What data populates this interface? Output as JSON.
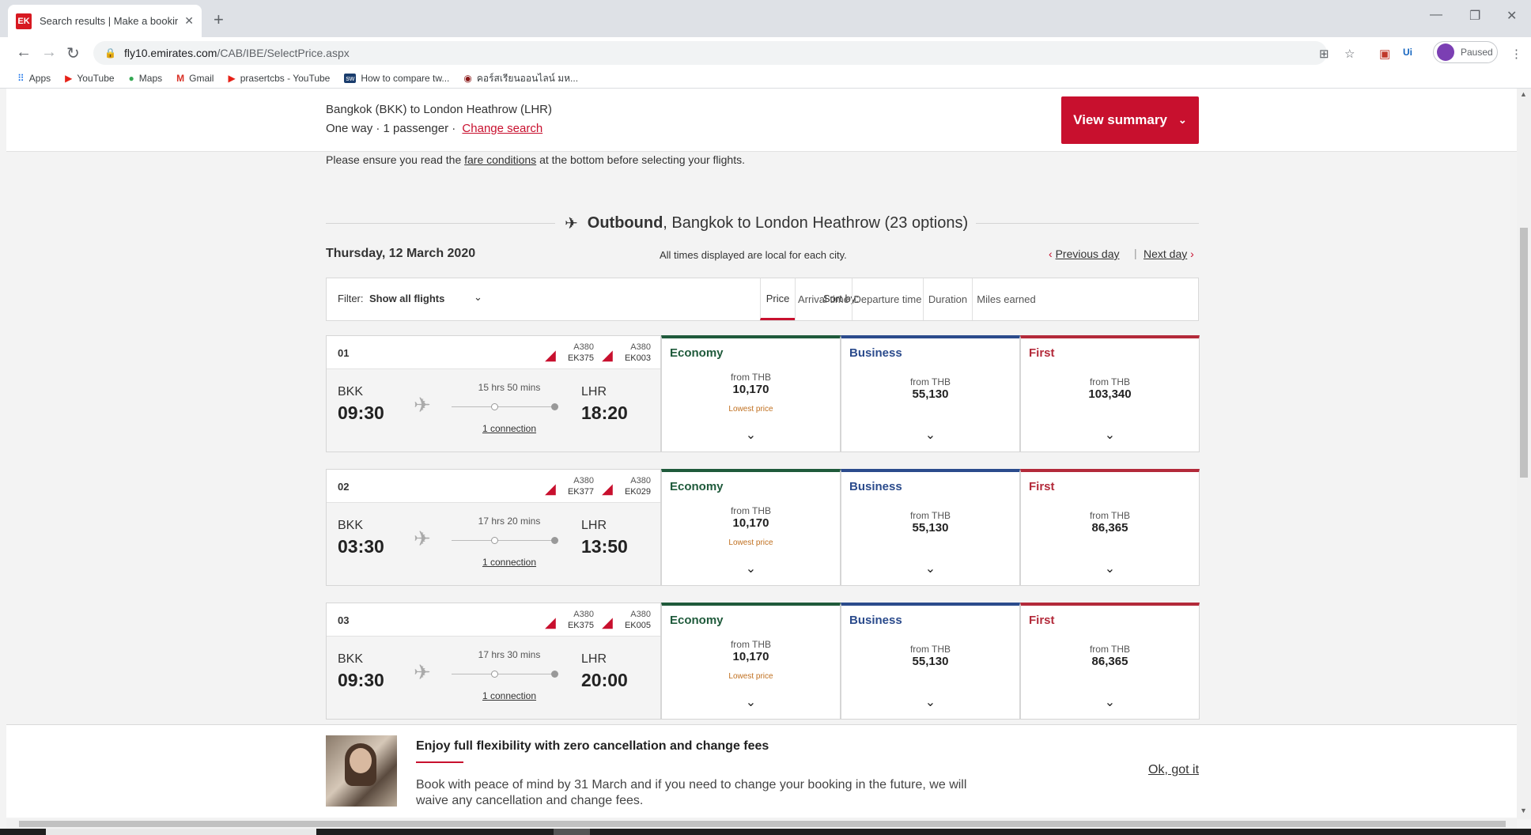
{
  "browser": {
    "tab_title": "Search results | Make a booking",
    "url_host": "fly10.emirates.com",
    "url_path": "/CAB/IBE/SelectPrice.aspx",
    "profile_label": "Paused",
    "bookmarks": [
      {
        "label": "Apps",
        "icon": "apps-grid-icon"
      },
      {
        "label": "YouTube",
        "icon": "youtube-icon"
      },
      {
        "label": "Maps",
        "icon": "maps-pin-icon"
      },
      {
        "label": "Gmail",
        "icon": "gmail-icon"
      },
      {
        "label": "prasertcbs - YouTube",
        "icon": "youtube-icon"
      },
      {
        "label": "How to compare tw...",
        "icon": "sw-icon"
      },
      {
        "label": "คอร์สเรียนออนไลน์ มห...",
        "icon": "mooc-icon"
      }
    ]
  },
  "summary": {
    "route": "Bangkok (BKK) to London Heathrow (LHR)",
    "trip_info": "One way · 1 passenger ·",
    "change_search": "Change search",
    "view_summary": "View summary"
  },
  "notice": {
    "before": "Please ensure you read the",
    "link": "fare conditions",
    "after": "at the bottom before selecting your flights."
  },
  "outbound": {
    "label": "Outbound",
    "rest": ", Bangkok to London Heathrow (23 options)"
  },
  "date_row": {
    "date": "Thursday, 12 March 2020",
    "local_note": "All times displayed are local for each city.",
    "previous_day": "Previous day",
    "next_day": "Next day"
  },
  "filter": {
    "label": "Filter:",
    "value": "Show all flights",
    "sort_label": "Sort by:",
    "sort_options": [
      "Price",
      "Arrival time",
      "Departure time",
      "Duration",
      "Miles earned"
    ],
    "active_sort": "Price"
  },
  "flights": [
    {
      "num": "01",
      "legs": [
        {
          "aircraft": "A380",
          "code": "EK375"
        },
        {
          "aircraft": "A380",
          "code": "EK003"
        }
      ],
      "dep_code": "BKK",
      "dep_time": "09:30",
      "duration": "15 hrs 50 mins",
      "arr_code": "LHR",
      "arr_time": "18:20",
      "connection": "1 connection",
      "fares": {
        "economy": {
          "label": "Economy",
          "from": "from THB",
          "price": "10,170",
          "note": "Lowest price"
        },
        "business": {
          "label": "Business",
          "from": "from THB",
          "price": "55,130"
        },
        "first": {
          "label": "First",
          "from": "from THB",
          "price": "103,340"
        }
      }
    },
    {
      "num": "02",
      "legs": [
        {
          "aircraft": "A380",
          "code": "EK377"
        },
        {
          "aircraft": "A380",
          "code": "EK029"
        }
      ],
      "dep_code": "BKK",
      "dep_time": "03:30",
      "duration": "17 hrs 20 mins",
      "arr_code": "LHR",
      "arr_time": "13:50",
      "connection": "1 connection",
      "fares": {
        "economy": {
          "label": "Economy",
          "from": "from THB",
          "price": "10,170",
          "note": "Lowest price"
        },
        "business": {
          "label": "Business",
          "from": "from THB",
          "price": "55,130"
        },
        "first": {
          "label": "First",
          "from": "from THB",
          "price": "86,365"
        }
      }
    },
    {
      "num": "03",
      "legs": [
        {
          "aircraft": "A380",
          "code": "EK375"
        },
        {
          "aircraft": "A380",
          "code": "EK005"
        }
      ],
      "dep_code": "BKK",
      "dep_time": "09:30",
      "duration": "17 hrs 30 mins",
      "arr_code": "LHR",
      "arr_time": "20:00",
      "connection": "1 connection",
      "fares": {
        "economy": {
          "label": "Economy",
          "from": "from THB",
          "price": "10,170",
          "note": "Lowest price"
        },
        "business": {
          "label": "Business",
          "from": "from THB",
          "price": "55,130"
        },
        "first": {
          "label": "First",
          "from": "from THB",
          "price": "86,365"
        }
      }
    }
  ],
  "promo": {
    "title": "Enjoy full flexibility with zero cancellation and change fees",
    "text": "Book with peace of mind by 31 March and if you need to change your booking in the future, we will waive any cancellation and change fees.",
    "dismiss": "Ok, got it"
  },
  "colors": {
    "brand_red": "#c8102e",
    "economy": "#1f5a3b",
    "business": "#2b4b8c",
    "first": "#b32a3a"
  }
}
